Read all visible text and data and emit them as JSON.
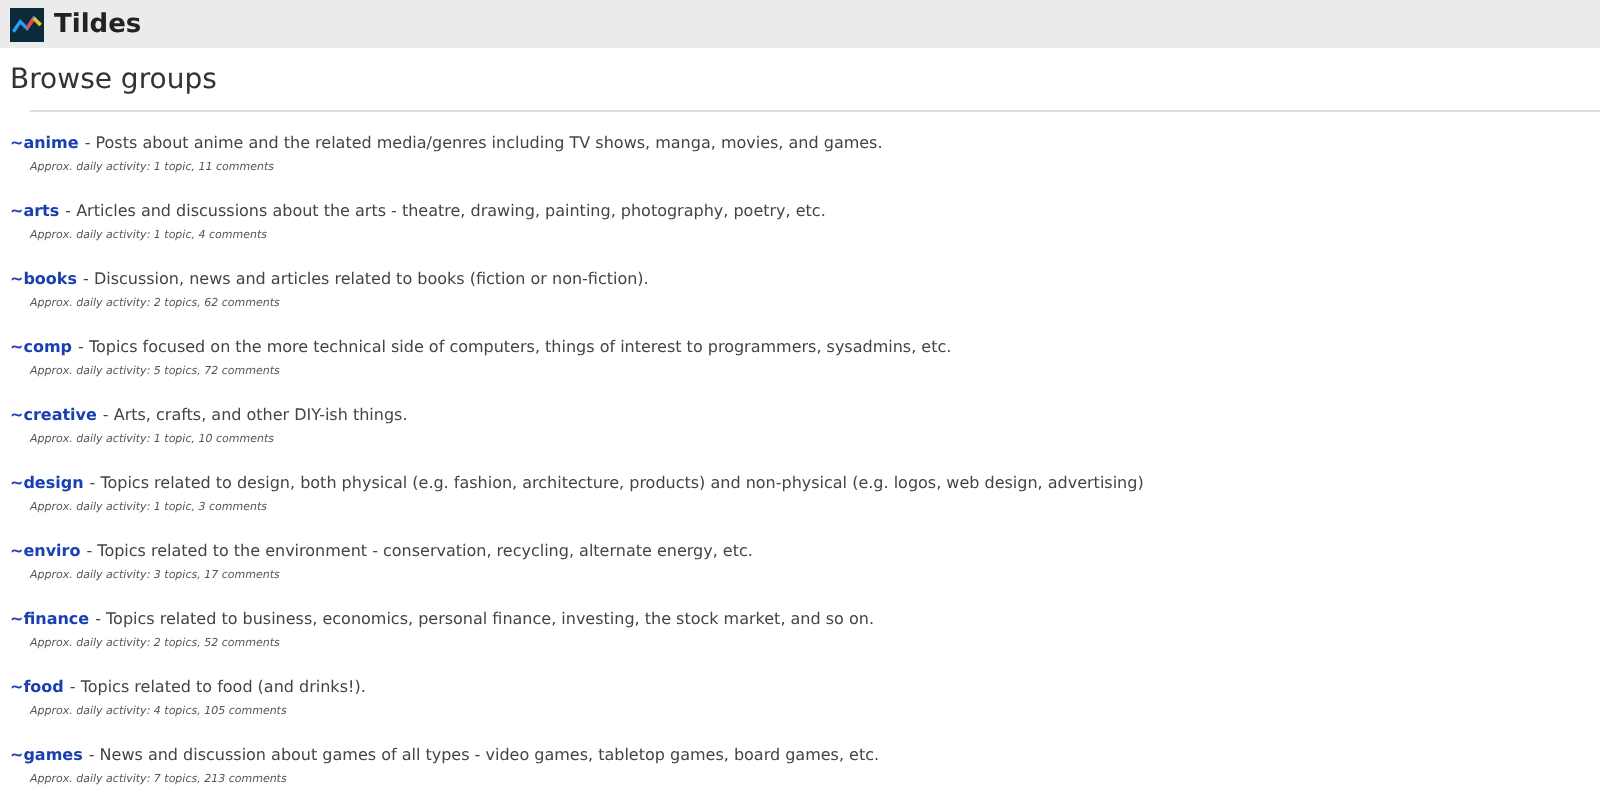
{
  "header": {
    "site_name": "Tildes"
  },
  "page_title": "Browse groups",
  "groups": [
    {
      "name": "~anime",
      "description": "- Posts about anime and the related media/genres including TV shows, manga, movies, and games.",
      "activity": "Approx. daily activity: 1 topic, 11 comments"
    },
    {
      "name": "~arts",
      "description": "- Articles and discussions about the arts - theatre, drawing, painting, photography, poetry, etc.",
      "activity": "Approx. daily activity: 1 topic, 4 comments"
    },
    {
      "name": "~books",
      "description": "- Discussion, news and articles related to books (fiction or non-fiction).",
      "activity": "Approx. daily activity: 2 topics, 62 comments"
    },
    {
      "name": "~comp",
      "description": "- Topics focused on the more technical side of computers, things of interest to programmers, sysadmins, etc.",
      "activity": "Approx. daily activity: 5 topics, 72 comments"
    },
    {
      "name": "~creative",
      "description": "- Arts, crafts, and other DIY-ish things.",
      "activity": "Approx. daily activity: 1 topic, 10 comments"
    },
    {
      "name": "~design",
      "description": "- Topics related to design, both physical (e.g. fashion, architecture, products) and non-physical (e.g. logos, web design, advertising)",
      "activity": "Approx. daily activity: 1 topic, 3 comments"
    },
    {
      "name": "~enviro",
      "description": "- Topics related to the environment - conservation, recycling, alternate energy, etc.",
      "activity": "Approx. daily activity: 3 topics, 17 comments"
    },
    {
      "name": "~finance",
      "description": "- Topics related to business, economics, personal finance, investing, the stock market, and so on.",
      "activity": "Approx. daily activity: 2 topics, 52 comments"
    },
    {
      "name": "~food",
      "description": "- Topics related to food (and drinks!).",
      "activity": "Approx. daily activity: 4 topics, 105 comments"
    },
    {
      "name": "~games",
      "description": "- News and discussion about games of all types - video games, tabletop games, board games, etc.",
      "activity": "Approx. daily activity: 7 topics, 213 comments"
    }
  ]
}
